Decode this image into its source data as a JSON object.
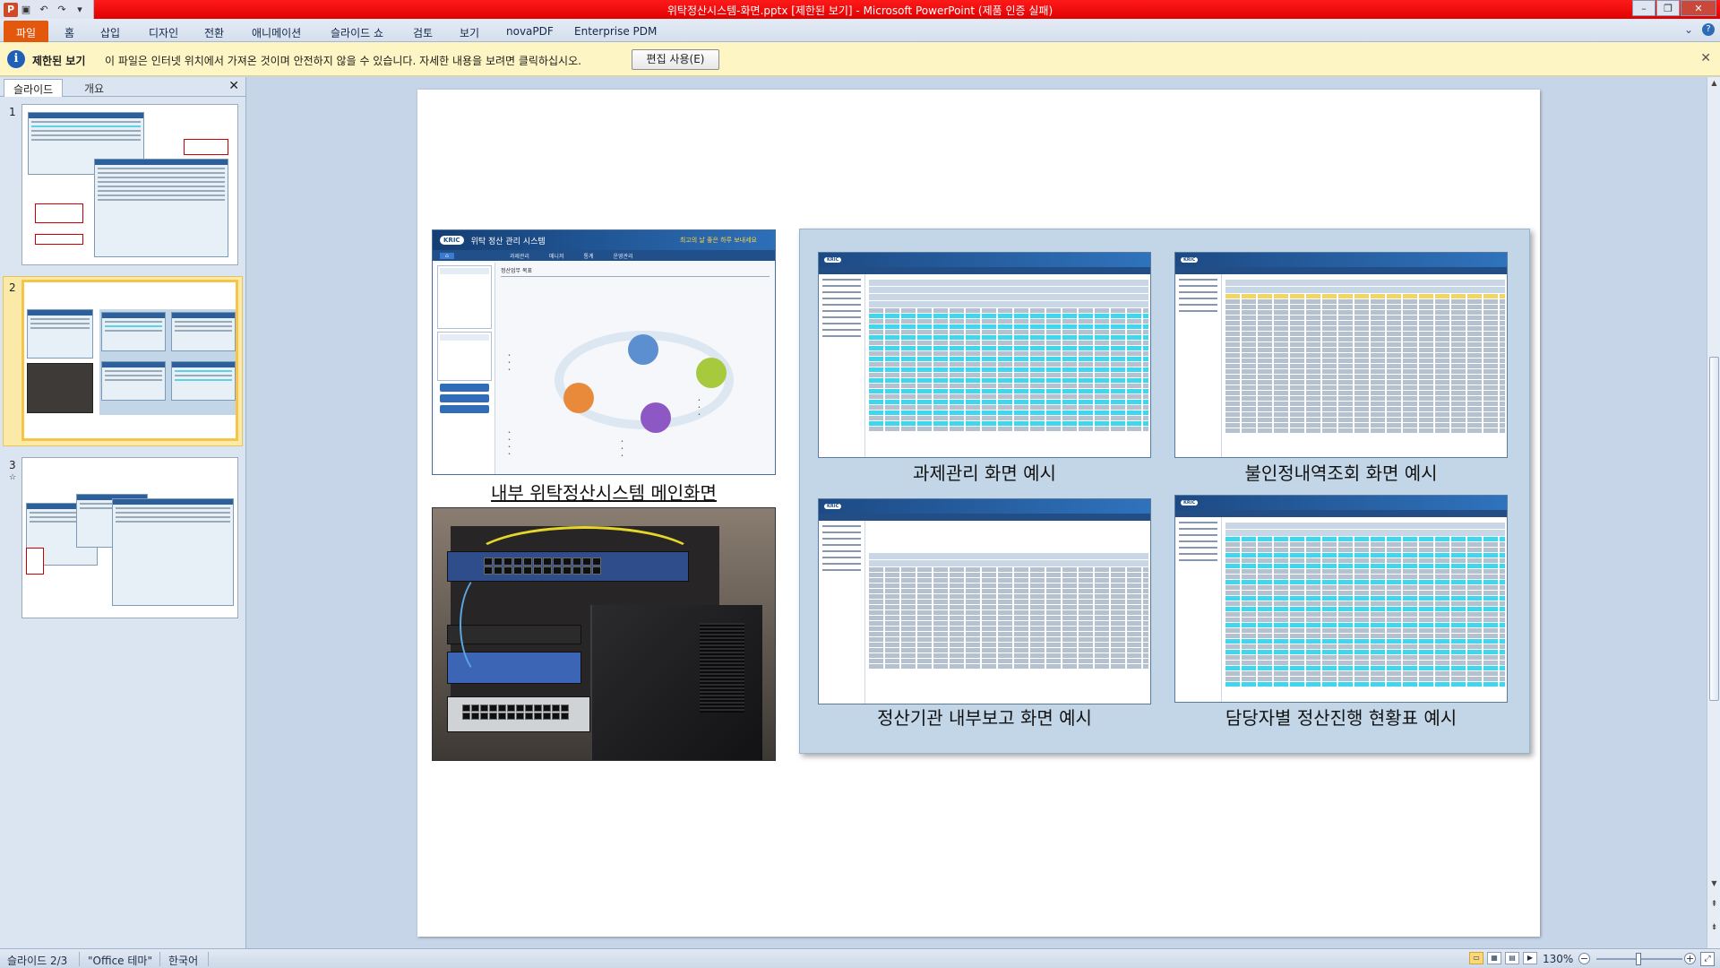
{
  "window": {
    "title": "위탁정산시스템-화면.pptx [제한된 보기] - Microsoft PowerPoint (제품 인증 실패)"
  },
  "ribbon": {
    "tabs": [
      "파일",
      "홈",
      "삽입",
      "디자인",
      "전환",
      "애니메이션",
      "슬라이드 쇼",
      "검토",
      "보기",
      "novaPDF",
      "Enterprise PDM"
    ]
  },
  "infobar": {
    "title": "제한된 보기",
    "message": "이 파일은 인터넷 위치에서 가져온 것이며 안전하지 않을 수 있습니다. 자세한 내용을 보려면 클릭하십시오.",
    "button": "편집 사용(E)"
  },
  "left_panel": {
    "tabs": [
      "슬라이드",
      "개요"
    ],
    "slides": [
      {
        "number": "1"
      },
      {
        "number": "2"
      },
      {
        "number": "3"
      }
    ]
  },
  "slide": {
    "main_screen": {
      "header_title": "위탁 정산 관리 시스템",
      "header_slogan": "최고의 날 좋은 하루 보내세요",
      "nav": [
        "과제관리",
        "매니저",
        "통계",
        "운영관리"
      ],
      "section_title": "정산업무 목표"
    },
    "captions": {
      "main": "내부 위탁정산시스템 메인화면",
      "shot1": "과제관리 화면 예시",
      "shot2": "불인정내역조회 화면 예시",
      "shot3": "정산기관 내부보고 화면 예시",
      "shot4": "담당자별 정산진행 현황표 예시"
    }
  },
  "statusbar": {
    "slide_pos": "슬라이드 2/3",
    "theme": "\"Office 테마\"",
    "language": "한국어",
    "zoom": "130%"
  },
  "colors": {
    "titlebar": "#e00000",
    "file_tab": "#e4580e",
    "infobar": "#fdf5c3",
    "selected_thumb": "#f5c449"
  }
}
